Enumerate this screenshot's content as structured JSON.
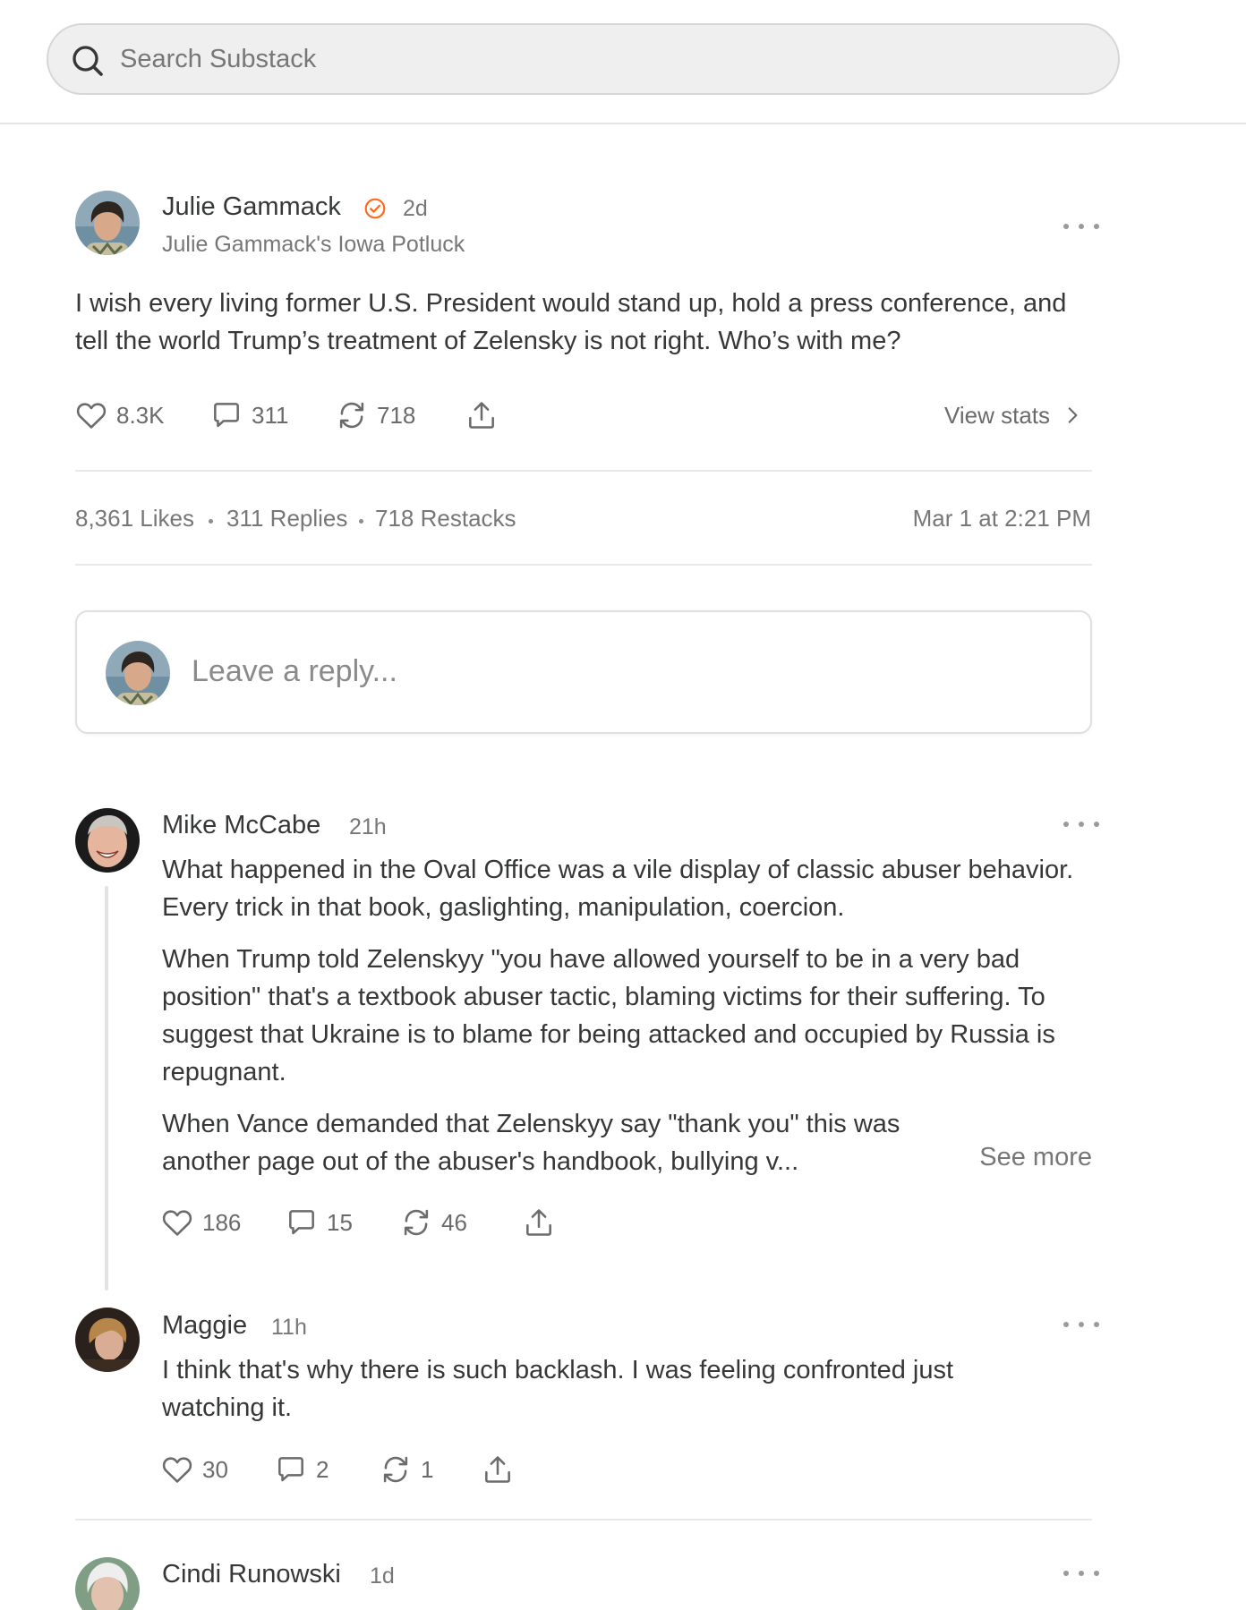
{
  "search": {
    "placeholder": "Search Substack",
    "icon": "search-icon"
  },
  "post": {
    "author": "Julie Gammack",
    "verified": true,
    "time": "2d",
    "publication": "Julie Gammack's Iowa Potluck",
    "text": "I wish every living former U.S. President would stand up, hold a press conference, and tell the world Trump’s treatment of Zelensky is not right. Who’s with me?",
    "likes": "8.3K",
    "comments": "311",
    "restacks": "718",
    "view_stats_label": "View stats",
    "stats": {
      "likes": "8,361 Likes",
      "replies": "311 Replies",
      "restacks": "718 Restacks",
      "date": "Mar 1 at 2:21 PM"
    }
  },
  "reply_box": {
    "placeholder": "Leave a reply..."
  },
  "comments": [
    {
      "author": "Mike McCabe",
      "time": "21h",
      "paragraphs": [
        "What happened in the Oval Office was a vile display of classic abuser behavior. Every trick in that book, gaslighting, manipulation, coercion.",
        "When Trump told Zelenskyy \"you have allowed yourself to be in a very bad position\" that's a textbook abuser tactic, blaming victims for their suffering. To suggest that Ukraine is to blame for being attacked and occupied by Russia is repugnant.",
        "When Vance demanded that Zelenskyy say \"thank you\" this was another page out of the abuser's handbook, bullying v..."
      ],
      "see_more_label": "See more",
      "likes": "186",
      "replies": "15",
      "restacks": "46"
    },
    {
      "author": "Maggie",
      "time": "11h",
      "paragraphs": [
        "I think that's why there is such backlash. I was feeling confronted just watching it."
      ],
      "likes": "30",
      "replies": "2",
      "restacks": "1"
    },
    {
      "author": "Cindi Runowski",
      "time": "1d"
    }
  ],
  "colors": {
    "accent_verified": "#ff6719",
    "text": "#363737",
    "muted": "#777777",
    "search_bg": "#efefef"
  }
}
